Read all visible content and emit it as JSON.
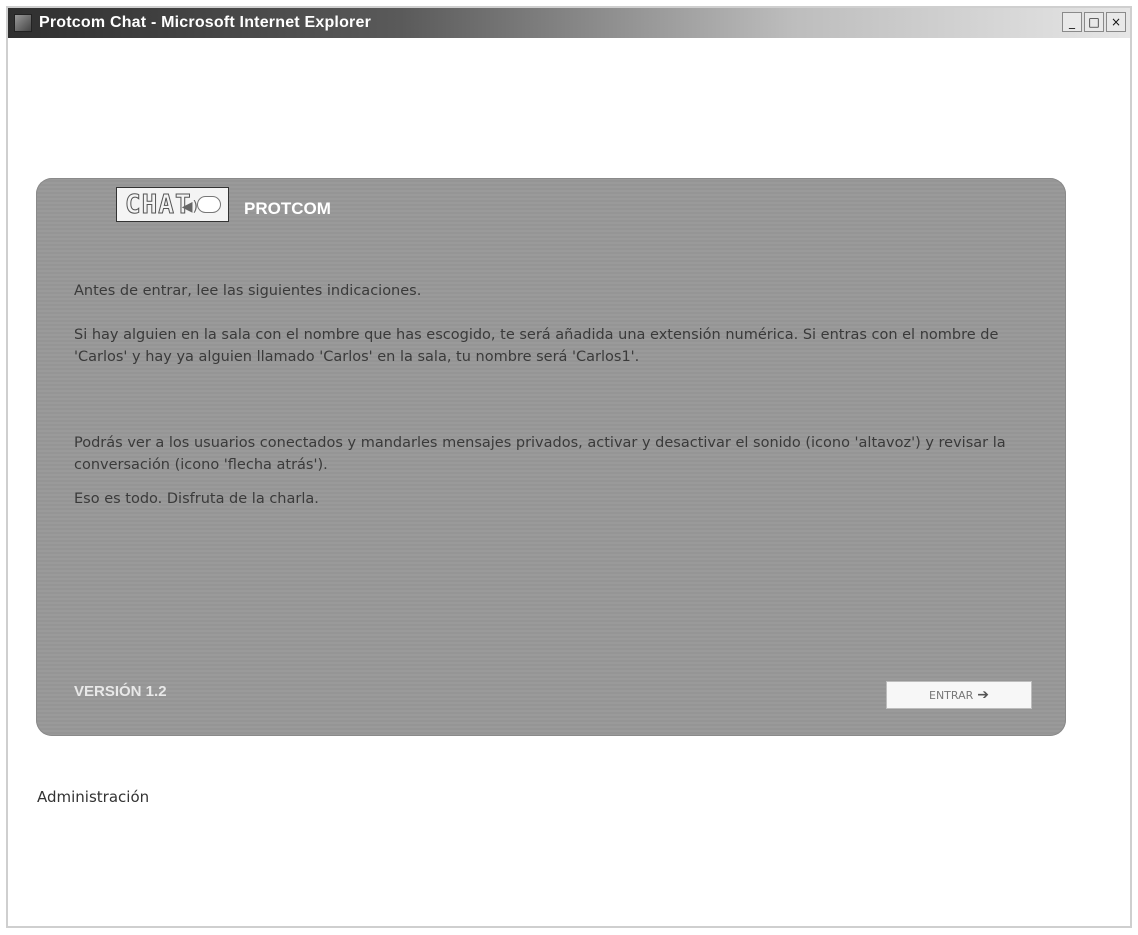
{
  "window": {
    "title": "Protcom Chat - Microsoft Internet Explorer",
    "minimize_glyph": "_",
    "maximize_glyph": "□",
    "close_glyph": "×"
  },
  "panel": {
    "logo_text": "CHAT",
    "logo_icon": "speaker-bubble-icon",
    "title": "PROTCOM",
    "paragraphs": [
      "Antes de entrar, lee las siguientes indicaciones.",
      "Si hay alguien en la sala con el nombre que has escogido, te será añadida una extensión numérica. Si entras con el nombre de 'Carlos' y hay ya alguien llamado 'Carlos' en la sala, tu nombre será 'Carlos1'.",
      "Podrás ver a los usuarios conectados y mandarles mensajes privados, activar y desactivar el sonido (icono 'altavoz') y revisar la conversación (icono 'flecha atrás').",
      "Eso es todo. Disfruta de la charla."
    ],
    "version": "VERSIÓN 1.2",
    "enter_button": {
      "label": "ENTRAR",
      "icon": "arrow-right-icon"
    }
  },
  "footer": {
    "admin_link": "Administración"
  },
  "colors": {
    "panel_bg": "#9a9a9a",
    "panel_title": "#ffffff",
    "body_text": "#3a3a3a"
  }
}
